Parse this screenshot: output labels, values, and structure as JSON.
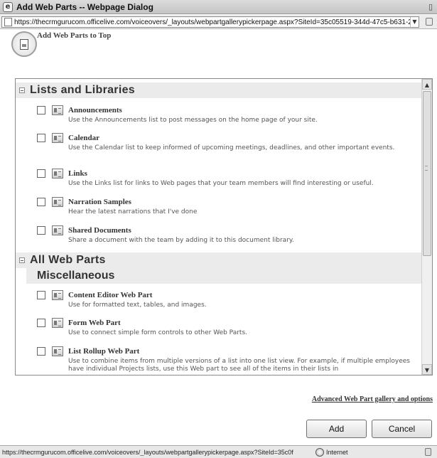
{
  "window": {
    "title": "Add Web Parts -- Webpage Dialog",
    "url": "https://thecrmgurucom.officelive.com/voiceovers/_layouts/webpartgallerypickerpage.aspx?SiteId=35c05519-344d-47c5-b631-21"
  },
  "header": {
    "title": "Add Web Parts to Top"
  },
  "gallery": {
    "lists_section": {
      "title": "Lists and Libraries",
      "items": [
        {
          "name": "Announcements",
          "description": "Use the Announcements list to post messages on the home page of your site.",
          "icon": "announcements-icon"
        },
        {
          "name": "Calendar",
          "description": "Use the Calendar list to keep informed of upcoming meetings, deadlines, and other important events.",
          "icon": "calendar-icon"
        },
        {
          "name": "Links",
          "description": "Use the Links list for links to Web pages that your team members will find interesting or useful.",
          "icon": "links-icon"
        },
        {
          "name": "Narration Samples",
          "description": "Hear the latest narrations that I've done",
          "icon": "document-library-icon"
        },
        {
          "name": "Shared Documents",
          "description": "Share a document with the team by adding it to this document library.",
          "icon": "document-library-icon"
        }
      ]
    },
    "webparts_section": {
      "title": "All Web Parts",
      "subsection": "Miscellaneous",
      "items": [
        {
          "name": "Content Editor Web Part",
          "description": "Use for formatted text, tables, and images.",
          "icon": "content-editor-icon"
        },
        {
          "name": "Form Web Part",
          "description": "Use to connect simple form controls to other Web Parts.",
          "icon": "form-icon"
        },
        {
          "name": "List Rollup Web Part",
          "description": "Use to combine items from multiple versions of a list into one list view.  For example, if multiple employees have individual Projects lists, use this Web part to see all of the items in their lists in",
          "icon": "list-rollup-icon"
        }
      ]
    }
  },
  "footer": {
    "advanced_link": "Advanced Web Part gallery and options",
    "add_label": "Add",
    "cancel_label": "Cancel"
  },
  "status": {
    "url": "https://thecrmgurucom.officelive.com/voiceovers/_layouts/webpartgallerypickerpage.aspx?SiteId=35c0f",
    "zone": "Internet"
  }
}
